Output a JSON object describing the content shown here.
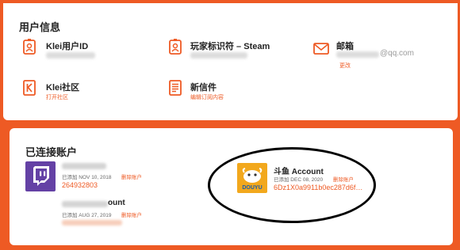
{
  "user_info": {
    "title": "用户信息",
    "klei_id": {
      "label": "Klei用户ID"
    },
    "steam_id": {
      "label": "玩家标识符 – Steam"
    },
    "email": {
      "label": "邮箱",
      "value_suffix": "@qq.com",
      "action": "更改"
    },
    "klei_forum": {
      "label": "Klei社区",
      "action": "打开社区"
    },
    "newsletter": {
      "label": "新信件",
      "action": "编辑订阅内容"
    }
  },
  "connected": {
    "title": "已连接账户",
    "accounts": [
      {
        "service": "twitch-icon",
        "added": "已添加 NOV 10, 2018",
        "unlink": "删除账户",
        "id": "264932803"
      },
      {
        "service": "google",
        "name_suffix": "ount",
        "added": "已添加 AUG 27, 2019",
        "unlink": "删除账户"
      },
      {
        "service": "douyu-icon",
        "name": "斗鱼 Account",
        "added": "已添加 DEC 08, 2020",
        "unlink": "删除账户",
        "id": "6Dz1X0a9911b0ec287d6f…"
      }
    ]
  },
  "colors": {
    "accent": "#ee5a24",
    "twitch": "#6441a5",
    "douyu": "#f2a81d"
  }
}
